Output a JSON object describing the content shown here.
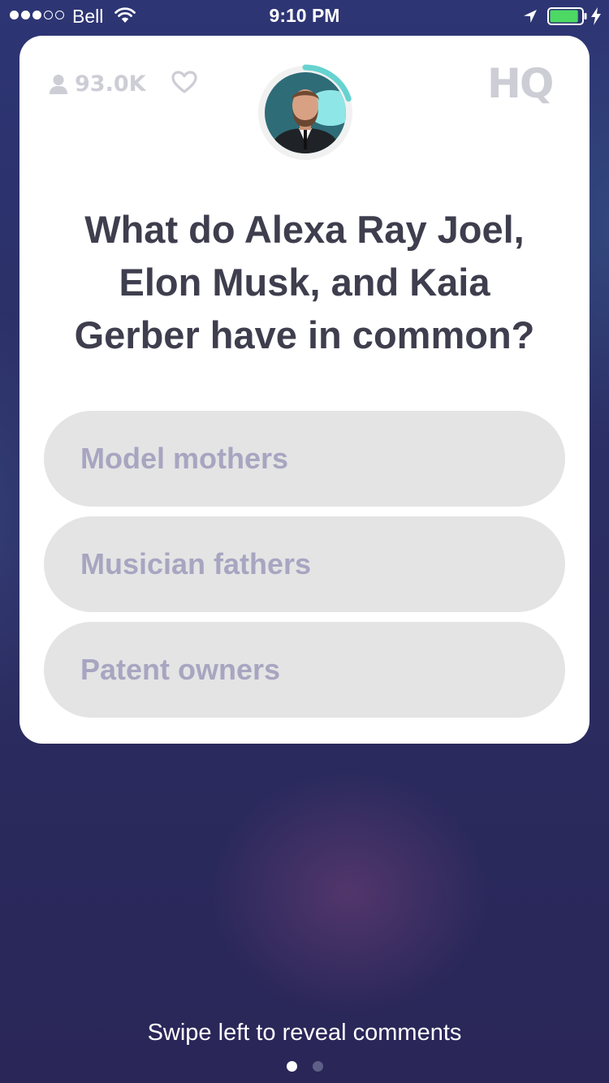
{
  "status_bar": {
    "carrier": "Bell",
    "time": "9:10 PM",
    "signal_strength": 3,
    "signal_max": 5,
    "battery_level": 0.9,
    "charging": true
  },
  "header": {
    "viewer_count": "93.0K",
    "logo_text": "HQ"
  },
  "question": {
    "text": "What do Alexa Ray Joel, Elon Musk, and Kaia Gerber have in common?"
  },
  "answers": [
    {
      "label": "Model mothers"
    },
    {
      "label": "Musician fathers"
    },
    {
      "label": "Patent owners"
    }
  ],
  "timer": {
    "progress": 0.2,
    "color": "#66d3d0"
  },
  "footer": {
    "hint": "Swipe left to reveal comments",
    "page_count": 2,
    "active_page": 1
  },
  "colors": {
    "background": "#2b2e63",
    "card": "#ffffff",
    "answer_fill": "#e4e4e4",
    "answer_text": "#a8a5c1",
    "question_text": "#3e3e4e",
    "muted_icon": "#cdcdd6",
    "battery_fill": "#4cd964"
  },
  "icons": [
    "wifi-icon",
    "location-arrow-icon",
    "battery-icon",
    "charging-bolt-icon",
    "person-icon",
    "heart-icon"
  ]
}
